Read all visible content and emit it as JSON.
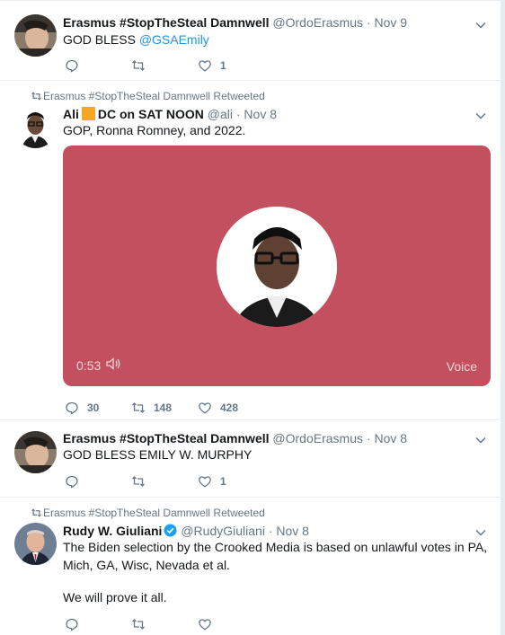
{
  "tweets": [
    {
      "name": "Erasmus #StopTheSteal Damnwell",
      "handle": "@OrdoErasmus",
      "dot": "·",
      "time": "Nov 9",
      "text_prefix": "GOD BLESS ",
      "mention": "@GSAEmily",
      "replies": "",
      "retweets": "",
      "likes": "1"
    },
    {
      "retweeted_by": "Erasmus #StopTheSteal Damnwell Retweeted",
      "name_part1": "Ali",
      "name_part2": "DC on SAT NOON",
      "handle": "@ali",
      "dot": "·",
      "time": "Nov 8",
      "text": "GOP, Ronna Romney, and 2022.",
      "media_time": "0:53",
      "media_label": "Voice",
      "replies": "30",
      "retweets": "148",
      "likes": "428"
    },
    {
      "name": "Erasmus #StopTheSteal Damnwell",
      "handle": "@OrdoErasmus",
      "dot": "·",
      "time": "Nov 8",
      "text": "GOD BLESS EMILY W. MURPHY",
      "replies": "",
      "retweets": "",
      "likes": "1"
    },
    {
      "retweeted_by": "Erasmus #StopTheSteal Damnwell Retweeted",
      "name": "Rudy W. Giuliani",
      "handle": "@RudyGiuliani",
      "dot": "·",
      "time": "Nov 8",
      "text_line1": "The Biden selection by the Crooked Media is based on unlawful votes in PA,",
      "text_line2": "Mich, GA, Wisc, Nevada et al.",
      "text_line3": "We will prove it all.",
      "replies": "",
      "retweets": "",
      "likes": ""
    }
  ],
  "colors": {
    "accent": "#1b95e0",
    "muted": "#657786",
    "media_bg": "#c2505e",
    "badge": "#f5a623",
    "verified": "#1da1f2"
  },
  "icons": [
    "reply-icon",
    "retweet-icon",
    "like-icon",
    "chevron-down-icon",
    "speaker-icon",
    "verified-icon"
  ]
}
